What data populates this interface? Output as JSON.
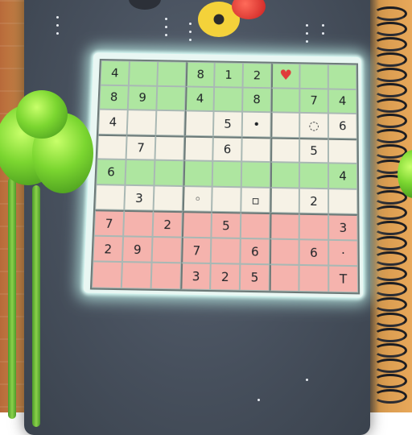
{
  "game": {
    "type": "sudoku",
    "rows": [
      [
        "4",
        "",
        "",
        "8",
        "1",
        "2",
        "♥",
        "",
        ""
      ],
      [
        "8",
        "9",
        "",
        "4",
        "",
        "8",
        "",
        "7",
        "4"
      ],
      [
        "4",
        "",
        "",
        "",
        "5",
        "•",
        "",
        "◌",
        "6"
      ],
      [
        "",
        "7",
        "",
        "",
        "6",
        "",
        "",
        "5",
        ""
      ],
      [
        "6",
        "",
        "",
        "",
        "",
        "",
        "",
        "",
        "4"
      ],
      [
        "",
        "3",
        "",
        "◦",
        "",
        "▫",
        "",
        "2",
        ""
      ],
      [
        "7",
        "",
        "2",
        "",
        "5",
        "",
        "",
        "",
        "3"
      ],
      [
        "2",
        "9",
        "",
        "7",
        "",
        "6",
        "",
        "6",
        "·"
      ],
      [
        "",
        "",
        "",
        "3",
        "2",
        "5",
        "",
        "",
        "T"
      ]
    ],
    "row_colors": [
      "g",
      "g",
      "c",
      "c",
      "g",
      "c",
      "r",
      "r",
      "r"
    ]
  },
  "colors": {
    "green_cell": "#aee6a0",
    "cream_cell": "#f6f2e6",
    "red_cell": "#f5b3ad",
    "heart": "#e03a3a",
    "glow": "#c8fff5"
  },
  "icons": {
    "heart": "heart-icon",
    "plant": "plant-icon",
    "spiral": "spiral-binding-icon"
  }
}
